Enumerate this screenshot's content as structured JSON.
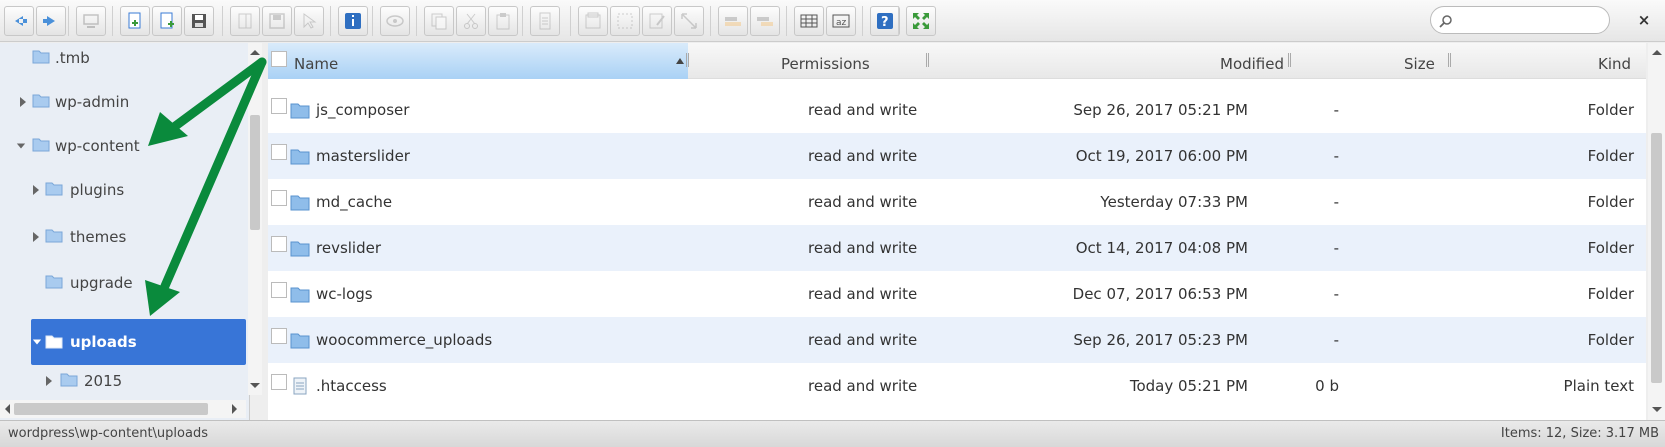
{
  "toolbar": {
    "buttons": [
      {
        "name": "back-icon",
        "color": "#4a90d9"
      },
      {
        "name": "forward-icon",
        "color": "#4a90d9"
      },
      {
        "name": "computer-icon",
        "color": "#888888"
      },
      {
        "name": "open-icon",
        "color": "#3a7bd5"
      },
      {
        "name": "new-file-icon",
        "color": "#3a7bd5"
      },
      {
        "name": "save-icon",
        "color": "#555555"
      },
      {
        "name": "copy-icon",
        "color": "#999999"
      },
      {
        "name": "disk-icon",
        "color": "#999999"
      },
      {
        "name": "select-icon",
        "color": "#999999"
      },
      {
        "name": "info-icon",
        "color": "#2f6fc1"
      },
      {
        "name": "view-icon",
        "color": "#999999"
      },
      {
        "name": "duplicate-icon",
        "color": "#999999"
      },
      {
        "name": "cut-icon",
        "color": "#999999"
      },
      {
        "name": "paste-icon",
        "color": "#999999"
      },
      {
        "name": "document-icon",
        "color": "#999999"
      },
      {
        "name": "archive-icon",
        "color": "#999999"
      },
      {
        "name": "select-area-icon",
        "color": "#999999"
      },
      {
        "name": "edit-icon",
        "color": "#999999"
      },
      {
        "name": "resize-icon",
        "color": "#999999"
      },
      {
        "name": "sort-icon",
        "color": "#999999"
      },
      {
        "name": "sort-alt-icon",
        "color": "#999999"
      },
      {
        "name": "grid-view-icon",
        "color": "#555555"
      },
      {
        "name": "text-view-icon",
        "color": "#555555"
      },
      {
        "name": "help-icon",
        "color": "#2f6fc1"
      },
      {
        "name": "fullscreen-icon",
        "color": "#3a9a3a"
      }
    ],
    "search_placeholder": "",
    "close_label": "×"
  },
  "tree": {
    "nodes": [
      {
        "label": ".tmb"
      },
      {
        "label": "wp-admin"
      },
      {
        "label": "wp-content"
      },
      {
        "label": "plugins"
      },
      {
        "label": "themes"
      },
      {
        "label": "upgrade"
      },
      {
        "label": "uploads"
      },
      {
        "label": "2015"
      }
    ],
    "selected_color": "#3875d7"
  },
  "list": {
    "headers": {
      "name": "Name",
      "permissions": "Permissions",
      "modified": "Modified",
      "size": "Size",
      "kind": "Kind"
    },
    "rows": [
      {
        "name": "js_composer",
        "permissions": "read and write",
        "modified": "Sep 26, 2017 05:21 PM",
        "size": "-",
        "kind": "Folder",
        "icon": "folder-icon"
      },
      {
        "name": "masterslider",
        "permissions": "read and write",
        "modified": "Oct 19, 2017 06:00 PM",
        "size": "-",
        "kind": "Folder",
        "icon": "folder-icon"
      },
      {
        "name": "md_cache",
        "permissions": "read and write",
        "modified": "Yesterday 07:33 PM",
        "size": "-",
        "kind": "Folder",
        "icon": "folder-icon"
      },
      {
        "name": "revslider",
        "permissions": "read and write",
        "modified": "Oct 14, 2017 04:08 PM",
        "size": "-",
        "kind": "Folder",
        "icon": "folder-icon"
      },
      {
        "name": "wc-logs",
        "permissions": "read and write",
        "modified": "Dec 07, 2017 06:53 PM",
        "size": "-",
        "kind": "Folder",
        "icon": "folder-icon"
      },
      {
        "name": "woocommerce_uploads",
        "permissions": "read and write",
        "modified": "Sep 26, 2017 05:23 PM",
        "size": "-",
        "kind": "Folder",
        "icon": "folder-icon"
      },
      {
        "name": ".htaccess",
        "permissions": "read and write",
        "modified": "Today 05:21 PM",
        "size": "0 b",
        "kind": "Plain text",
        "icon": "text-file-icon"
      }
    ]
  },
  "status": {
    "path": "wordpress\\wp-content\\uploads",
    "info": "Items: 12, Size: 3.17 MB"
  },
  "annotation_color": "#0a8a3c"
}
